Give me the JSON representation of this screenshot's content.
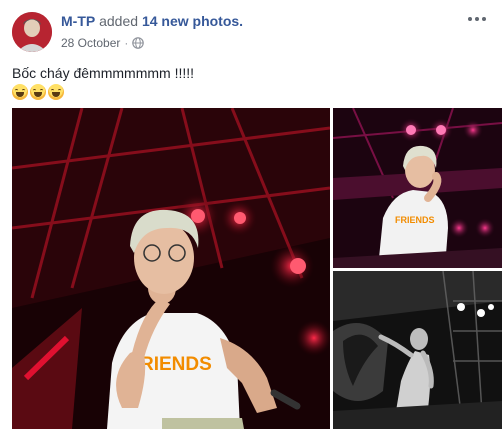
{
  "post": {
    "author": "M-TP",
    "action": "added",
    "photos_link": "14 new photos.",
    "date": "28 October",
    "separator": "·",
    "caption": "Bốc cháy đêmmmmmmm !!!!!",
    "emoji_icons": [
      "grinning-sweat-emoji",
      "grinning-sweat-emoji",
      "grinning-sweat-emoji"
    ],
    "privacy_icon": "globe-icon",
    "menu_icon": "more-options-icon"
  },
  "gallery": {
    "photos": [
      {
        "name": "photo-main",
        "print_text": "RIENDS"
      },
      {
        "name": "photo-side-top",
        "print_text": "FRIENDS"
      },
      {
        "name": "photo-side-bottom",
        "print_text": ""
      }
    ]
  },
  "colors": {
    "link_blue": "#365899",
    "meta_gray": "#616770",
    "text_dark": "#1d2129",
    "stage_red": "#c8102e",
    "shirt_orange": "#f28c00"
  }
}
